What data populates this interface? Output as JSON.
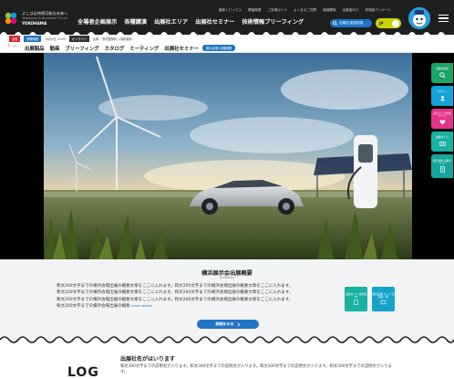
{
  "header": {
    "logo": {
      "line1": "よこはま持続可能な未来へ",
      "line2": "Yokohama Sustainable Future",
      "line3": "YOKOHAMA"
    },
    "main_nav": [
      "全場者企画展示",
      "各種講演",
      "出展社エリア",
      "出展社セミナー",
      "技術情報ブリーフィング"
    ],
    "util_nav": [
      "最新トピックス",
      "開催概要",
      "ご来場ガイド",
      "よくあるご質問",
      "報道関係",
      "出展者向け",
      "来場者アンケート"
    ],
    "search_label": "出展社/製品検索",
    "lang_label": "JP",
    "colors": {
      "header_bg": "#1f1f1f",
      "accent_blue": "#1e73c6",
      "toggle": "#c8d400"
    }
  },
  "info_bar": {
    "tag_date": "会期",
    "tag_time": "開場時間",
    "tag_online": "オンライン",
    "txt_date": "10月9日 10:00",
    "txt_time": "会場",
    "txt_note": "事前登録制 入場料無料"
  },
  "sub_nav": {
    "home_label": "ホーム",
    "items": [
      "出展製品",
      "動画",
      "ブリーフィング",
      "カタログ",
      "ミーティング",
      "出展社セミナー"
    ],
    "badge": "展示会場 出展概要"
  },
  "side_buttons": [
    {
      "label": "出展社検索",
      "color": "#1aa56a"
    },
    {
      "label": "ログイン",
      "color": "#15a3d6"
    },
    {
      "label": "お気に入り出展ページ",
      "color": "#e3338c"
    },
    {
      "label": "会場マップ",
      "color": "#17b2a0"
    },
    {
      "label": "展示会場 出展ガイド",
      "color": "#12a79a"
    }
  ],
  "exhibit": {
    "title": "横浜展示会出展概要",
    "subtitle": "Exhibition",
    "body": [
      "和文200文字までの横浜会場出展の概要文章をここに入れます。和文200文字までの横浜会場出展の概要文章をここに入れます。",
      "和文200文字までの横浜会場出展の概要文章をここに入れます。和文200文字までの横浜会場出展の概要文章をここに入れます。",
      "和文200文字までの横浜会場出展の概要文章をここに入れます。和文200文字までの横浜会場出展の概要文章をここに入れます。",
      "和文200文字までの横浜会場出展の概要"
    ],
    "more_label": "more details",
    "card_a": "出展ガイド 会場案内",
    "card_b": "展示会場 マップ 出展社一覧",
    "cta_label": "詳細をみる"
  },
  "bottom": {
    "big_text": "LOG",
    "section_title": "出展社名がはいります",
    "section_body": "和文300文字までの説明文が入ります。和文300文字までの説明文が入ります。和文300文字までの説明文が入ります。和文300文字までの説明文が入ります。"
  }
}
